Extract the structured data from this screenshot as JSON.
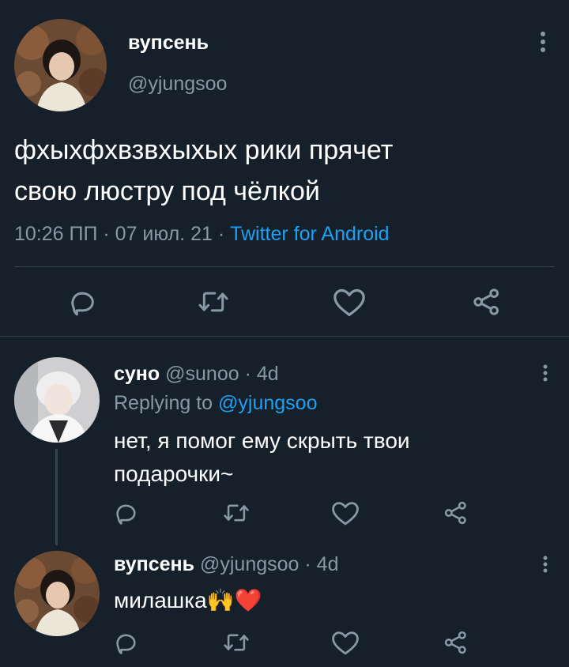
{
  "main_tweet": {
    "author_name": "вупсень",
    "author_handle": "@yjungsoo",
    "text_line1": "фхыхфхвзвхыхых рики прячет",
    "text_line2": "свою люстру под чёлкой",
    "time": "10:26 ПП",
    "sep1": " · ",
    "date": "07 июл. 21",
    "sep2": " · ",
    "source": "Twitter for Android"
  },
  "replies": [
    {
      "author_name": "суно",
      "author_handle": "@sunoo",
      "age": "· 4d",
      "replying_prefix": "Replying to ",
      "replying_handle": "@yjungsoo",
      "text_line1": "нет, я помог ему скрыть твои",
      "text_line2": "подарочки~"
    },
    {
      "author_name": "вупсень",
      "author_handle": "@yjungsoo",
      "age": "· 4d",
      "text": "милашка🙌❤️"
    }
  ],
  "icons": [
    "reply-icon",
    "retweet-icon",
    "like-icon",
    "share-icon",
    "more-icon"
  ],
  "colors": {
    "background": "#15202b",
    "text": "#ffffff",
    "muted": "#8899a6",
    "accent": "#1da1f2",
    "divider": "#38444d"
  }
}
